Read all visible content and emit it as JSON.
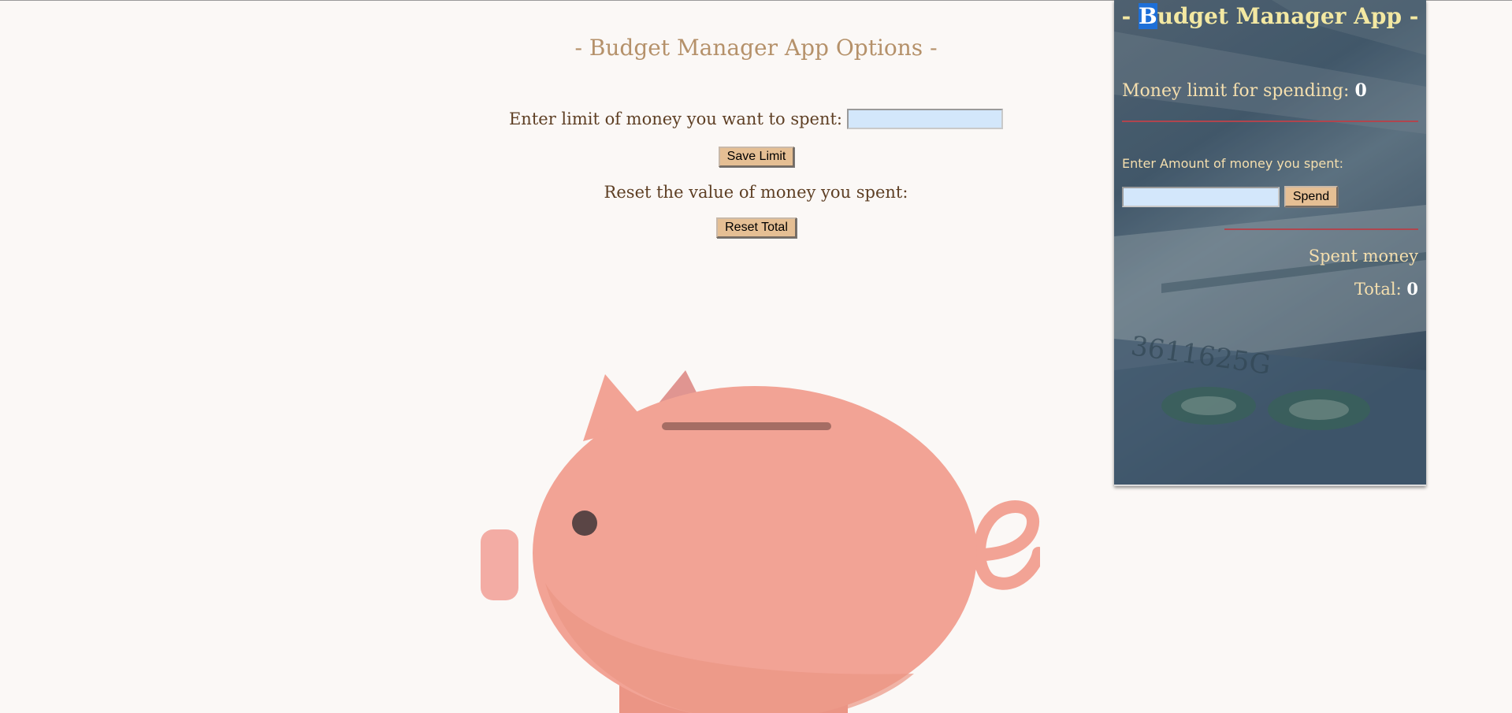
{
  "options": {
    "title": "- Budget Manager App Options -",
    "limit_label": "Enter limit of money you want to spent:",
    "limit_value": "",
    "save_label": "Save Limit",
    "reset_label": "Reset the value of money you spent:",
    "reset_button": "Reset Total"
  },
  "panel": {
    "title_prefix": "- ",
    "title_highlight": "B",
    "title_rest": "udget Manager App -",
    "limit_label": "Money limit for spending:",
    "limit_value": "0",
    "enter_label": "Enter Amount of money you spent:",
    "spend_value": "",
    "spend_button": "Spend",
    "spent_label": "Spent money",
    "total_label": "Total:",
    "total_value": "0"
  },
  "colors": {
    "page_background": "#fbf8f6",
    "title": "#b5916a",
    "label": "#5e3f24",
    "button": "#e5bf94",
    "input": "#d3e7fb",
    "panel_title": "#f3e8a2",
    "panel_text": "#f5dfae",
    "divider": "#b0454e",
    "pig": "#f2a395"
  },
  "images": {
    "background_illustration": "piggy-bank",
    "panel_background": "dollar-banknotes-photo"
  }
}
